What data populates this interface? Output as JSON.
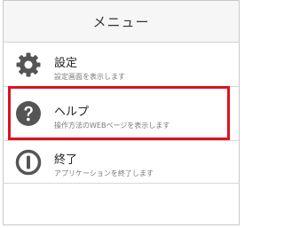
{
  "header": {
    "title": "メニュー"
  },
  "menu": {
    "items": [
      {
        "label": "設定",
        "description": "設定画面を表示します",
        "icon": "gear-icon"
      },
      {
        "label": "ヘルプ",
        "description": "操作方法のWEBページを表示します",
        "icon": "help-icon"
      },
      {
        "label": "終了",
        "description": "アプリケーションを終了します",
        "icon": "power-icon"
      }
    ]
  },
  "colors": {
    "highlight": "#e0101e",
    "icon": "#555555"
  }
}
